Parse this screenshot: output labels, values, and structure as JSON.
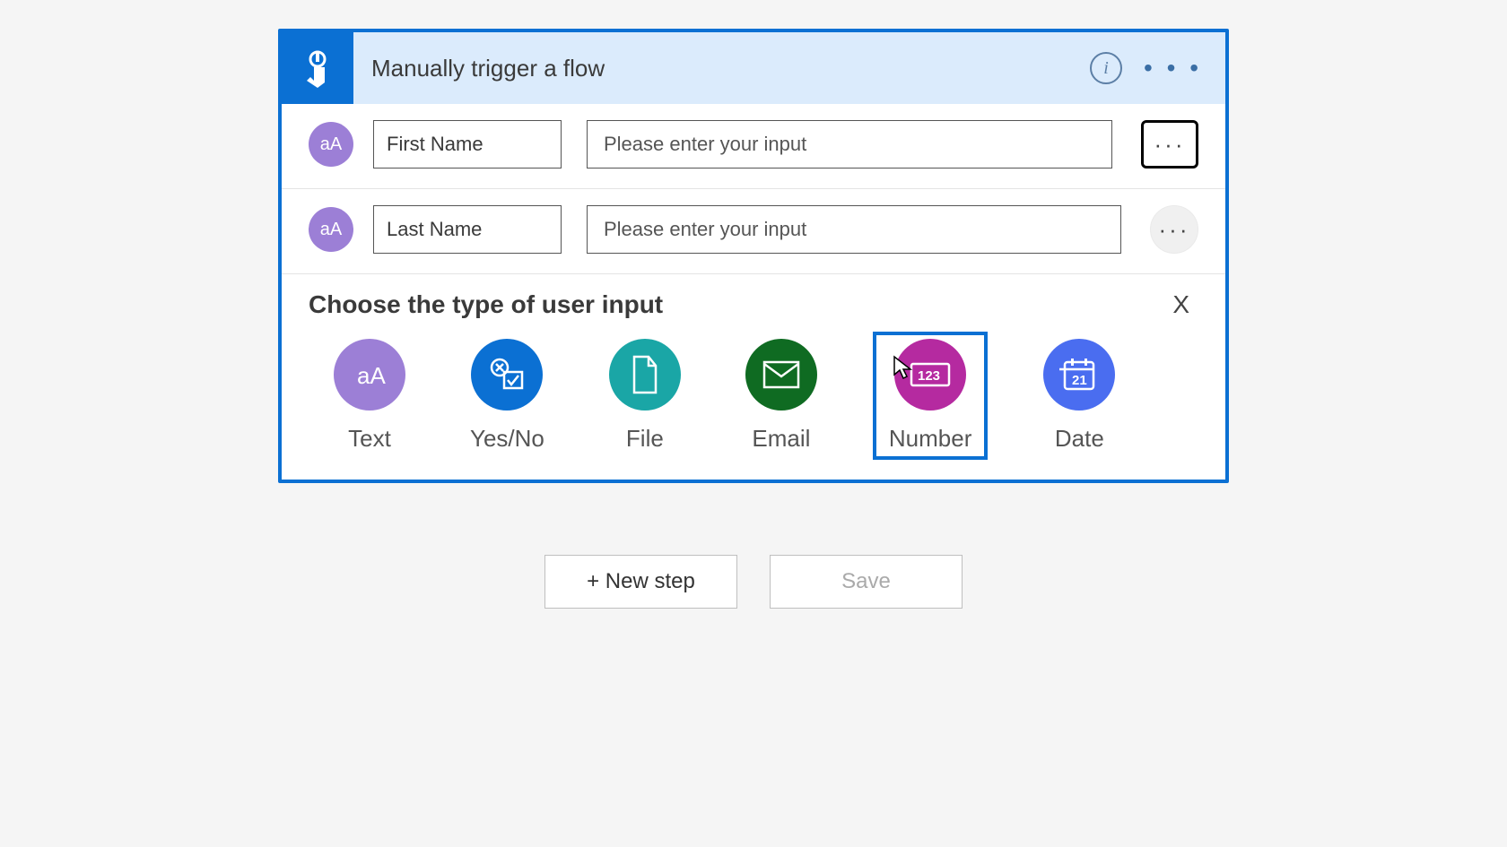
{
  "trigger": {
    "title": "Manually trigger a flow",
    "info_symbol": "i",
    "menu_dots": "• • •"
  },
  "inputs": [
    {
      "icon": "aA",
      "label": "First Name",
      "placeholder": "Please enter your input",
      "menu_focused": true,
      "menu_shape": "box"
    },
    {
      "icon": "aA",
      "label": "Last Name",
      "placeholder": "Please enter your input",
      "menu_focused": false,
      "menu_shape": "round"
    }
  ],
  "chooser": {
    "title": "Choose the type of user input",
    "close": "X",
    "types": [
      {
        "key": "text",
        "label": "Text",
        "color": "c-text"
      },
      {
        "key": "yesno",
        "label": "Yes/No",
        "color": "c-yesno"
      },
      {
        "key": "file",
        "label": "File",
        "color": "c-file"
      },
      {
        "key": "email",
        "label": "Email",
        "color": "c-email"
      },
      {
        "key": "number",
        "label": "Number",
        "color": "c-number",
        "selected": true
      },
      {
        "key": "date",
        "label": "Date",
        "color": "c-date"
      }
    ]
  },
  "footer": {
    "new_step": "+ New step",
    "save": "Save"
  }
}
